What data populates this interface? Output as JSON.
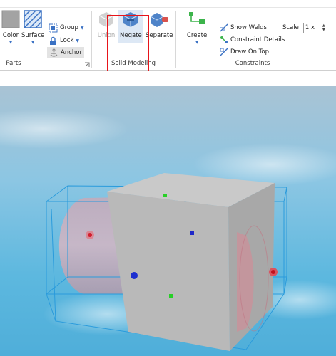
{
  "ribbon": {
    "parts_group": {
      "label": "Parts",
      "color_label": "Color",
      "surface_label": "Surface",
      "group_label": "Group",
      "lock_label": "Lock",
      "anchor_label": "Anchor"
    },
    "solid_modeling_group": {
      "label": "Solid Modeling",
      "union_label": "Union",
      "negate_label": "Negate",
      "separate_label": "Separate"
    },
    "constraints_group": {
      "label": "Constraints",
      "create_label": "Create",
      "show_welds_label": "Show Welds",
      "constraint_details_label": "Constraint Details",
      "draw_on_top_label": "Draw On Top",
      "scale_label": "Scale",
      "scale_value": "1 x"
    }
  },
  "colors": {
    "accent_blue": "#3b72c4",
    "highlight_red": "#e8141a",
    "sky_top": "#a8c4d6",
    "sky_bottom": "#5ab9e0",
    "block_front": "#b8b8b8",
    "block_top": "#c8c8c8",
    "block_side": "#a9a9a9",
    "selection_box": "#2a9bdc"
  },
  "viewport": {
    "scene_description_icons": [
      "cylinder-negated-part",
      "block-part",
      "selection-box",
      "attachment-dots"
    ]
  }
}
